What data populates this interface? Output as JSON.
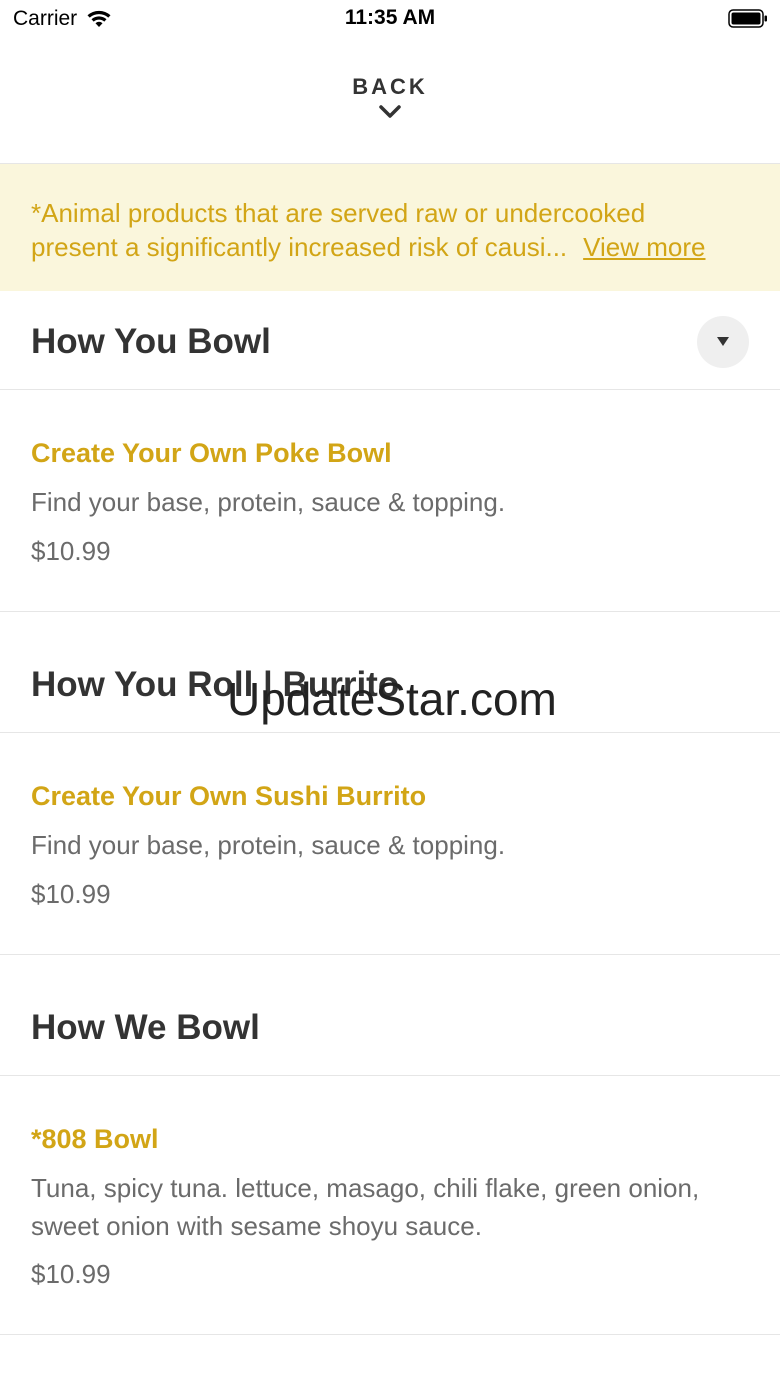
{
  "status_bar": {
    "carrier": "Carrier",
    "time": "11:35 AM"
  },
  "header": {
    "back_label": "BACK"
  },
  "notice": {
    "line1": "*Animal products that are served raw or undercooked",
    "line2": "present a significantly increased risk of causi...",
    "link": "View more"
  },
  "sections": [
    {
      "title": "How You Bowl",
      "items": [
        {
          "name": "Create Your Own Poke Bowl",
          "description": "Find your base, protein, sauce & topping.",
          "price": "$10.99"
        }
      ]
    },
    {
      "title": "How You Roll | Burrito",
      "items": [
        {
          "name": "Create Your Own Sushi Burrito",
          "description": "Find your base, protein, sauce & topping.",
          "price": "$10.99"
        }
      ]
    },
    {
      "title": "How We Bowl",
      "items": [
        {
          "name": "*808 Bowl",
          "description_line1": "Tuna, spicy tuna. lettuce, masago, chili flake, green onion,",
          "description_line2": "sweet onion with sesame shoyu sauce.",
          "price": "$10.99"
        }
      ]
    }
  ],
  "watermark": "UpdateStar.com",
  "colors": {
    "accent": "#d2a516",
    "notice_bg": "#faf6dc",
    "title_text": "#333333",
    "muted_text": "#6b6b6b"
  }
}
